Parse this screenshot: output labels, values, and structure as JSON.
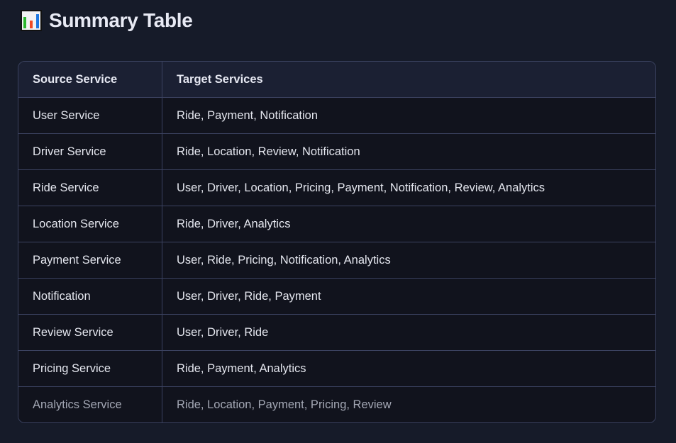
{
  "title": "Summary Table",
  "title_icon": "bar-chart-icon",
  "table": {
    "headers": [
      "Source Service",
      "Target Services"
    ],
    "rows": [
      [
        "User Service",
        "Ride, Payment, Notification"
      ],
      [
        "Driver Service",
        "Ride, Location, Review, Notification"
      ],
      [
        "Ride Service",
        "User, Driver, Location, Pricing, Payment, Notification, Review, Analytics"
      ],
      [
        "Location Service",
        "Ride, Driver, Analytics"
      ],
      [
        "Payment Service",
        "User, Ride, Pricing, Notification, Analytics"
      ],
      [
        "Notification",
        "User, Driver, Ride, Payment"
      ],
      [
        "Review Service",
        "User, Driver, Ride"
      ],
      [
        "Pricing Service",
        "Ride, Payment, Analytics"
      ],
      [
        "Analytics Service",
        "Ride, Location, Payment, Pricing, Review"
      ]
    ]
  }
}
